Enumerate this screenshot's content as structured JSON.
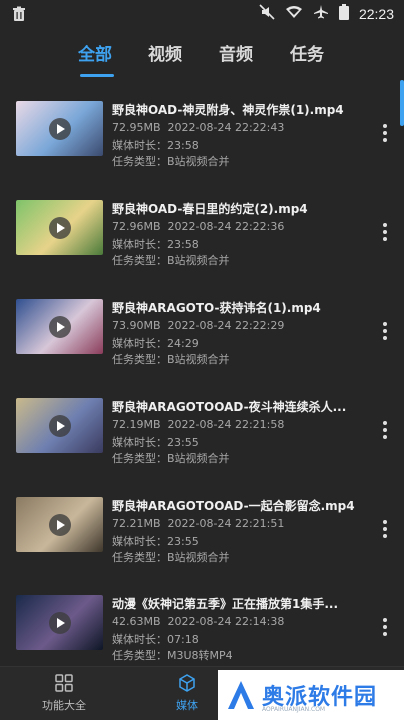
{
  "status": {
    "time": "22:23"
  },
  "tabs": [
    "全部",
    "视频",
    "音频",
    "任务"
  ],
  "items": [
    {
      "title": "野良神OAD-神灵附身、神灵作祟(1).mp4",
      "size": "72.95MB",
      "date": "2022-08-24 22:22:43",
      "duration_label": "媒体时长：",
      "duration": "23:58",
      "type_label": "任务类型：",
      "type": "B站视频合并",
      "thumb": [
        "#e9d9e6",
        "#7aa7d8",
        "#3b4a6e"
      ]
    },
    {
      "title": "野良神OAD-春日里的约定(2).mp4",
      "size": "72.96MB",
      "date": "2022-08-24 22:22:36",
      "duration_label": "媒体时长：",
      "duration": "23:58",
      "type_label": "任务类型：",
      "type": "B站视频合并",
      "thumb": [
        "#7ec36a",
        "#e7d38a",
        "#4a7a3a"
      ]
    },
    {
      "title": "野良神ARAGOTO-获持讳名(1).mp4",
      "size": "73.90MB",
      "date": "2022-08-24 22:22:29",
      "duration_label": "媒体时长：",
      "duration": "24:29",
      "type_label": "任务类型：",
      "type": "B站视频合并",
      "thumb": [
        "#2f4f8f",
        "#d7c7d8",
        "#8a3c5a"
      ]
    },
    {
      "title": "野良神ARAGOTOOAD-夜斗神连续杀人...",
      "size": "72.19MB",
      "date": "2022-08-24 22:21:58",
      "duration_label": "媒体时长：",
      "duration": "23:55",
      "type_label": "任务类型：",
      "type": "B站视频合并",
      "thumb": [
        "#c9b98a",
        "#6e7fb0",
        "#3a3a5e"
      ]
    },
    {
      "title": "野良神ARAGOTOOAD-一起合影留念.mp4",
      "size": "72.21MB",
      "date": "2022-08-24 22:21:51",
      "duration_label": "媒体时长：",
      "duration": "23:55",
      "type_label": "任务类型：",
      "type": "B站视频合并",
      "thumb": [
        "#8a7a62",
        "#c8b79a",
        "#3f372c"
      ]
    },
    {
      "title": "动漫《妖神记第五季》正在播放第1集手...",
      "size": "42.63MB",
      "date": "2022-08-24 22:14:38",
      "duration_label": "媒体时长：",
      "duration": "07:18",
      "type_label": "任务类型：",
      "type": "M3U8转MP4",
      "thumb": [
        "#1a2a4a",
        "#6c5a8a",
        "#0e1626"
      ]
    }
  ],
  "bottom_nav": {
    "left_label": "功能大全",
    "mid_label": "媒体"
  },
  "watermark": {
    "text": "奥派软件园",
    "sub": "AOPAIRUANJIAN.COM"
  },
  "colors": {
    "accent": "#3ea2f0",
    "background": "#262626"
  }
}
